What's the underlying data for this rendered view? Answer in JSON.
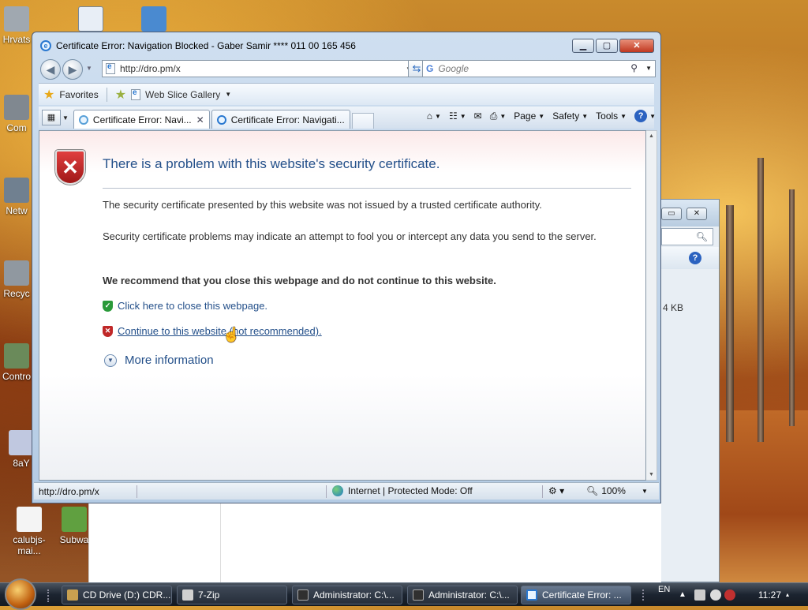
{
  "desktop": {
    "icons": [
      {
        "label": "Hrvats",
        "color": "#a0a8b0"
      },
      {
        "label": "Com",
        "color": "#808890"
      },
      {
        "label": "Netw",
        "color": "#708090"
      },
      {
        "label": "Recyc",
        "color": "#9098a0"
      },
      {
        "label": "Contro",
        "color": "#6a8a5a"
      },
      {
        "label": "8aY",
        "color": "#c0c8e0"
      },
      {
        "label": "calubjs-mai...",
        "color": "#f4f4f4"
      },
      {
        "label": "Subwa",
        "color": "#60a040"
      }
    ]
  },
  "background_window": {
    "minimize": "▭",
    "close": "✕",
    "search_icon": "search-icon",
    "size_text": "4 KB",
    "help": "?"
  },
  "browser": {
    "title": "Certificate Error: Navigation Blocked - Gaber Samir **** 011 00 165 456",
    "window_buttons": {
      "minimize": "▁",
      "maximize": "▢",
      "close": "✕"
    },
    "back": "◀",
    "forward": "▶",
    "address": "http://dro.pm/x",
    "search_placeholder": "Google",
    "favorites_label": "Favorites",
    "web_slice_label": "Web Slice Gallery",
    "tabs": [
      {
        "label": "Certificate Error: Navi..."
      },
      {
        "label": "Certificate Error: Navigati..."
      }
    ],
    "commands": {
      "page": "Page",
      "safety": "Safety",
      "tools": "Tools",
      "help": "?"
    },
    "content": {
      "heading": "There is a problem with this website's security certificate.",
      "para1": "The security certificate presented by this website was not issued by a trusted certificate authority.",
      "para2": "Security certificate problems may indicate an attempt to fool you or intercept any data you send to the server.",
      "recommend": "We recommend that you close this webpage and do not continue to this website.",
      "close_link": "Click here to close this webpage.",
      "continue_link": "Continue to this website (not recommended).",
      "more_info": "More information"
    },
    "status": {
      "url": "http://dro.pm/x",
      "zone": "Internet | Protected Mode: Off",
      "zoom": "100%"
    }
  },
  "taskbar": {
    "items": [
      {
        "label": "CD Drive (D:) CDR...",
        "color": "#c8a050"
      },
      {
        "label": "7-Zip",
        "color": "#d0d0d0"
      },
      {
        "label": "Administrator: C:\\...",
        "color": "#303030"
      },
      {
        "label": "Administrator: C:\\...",
        "color": "#303030"
      },
      {
        "label": "Certificate Error: ...",
        "color": "#2a78d0"
      }
    ],
    "language": "EN",
    "clock": "11:27"
  }
}
